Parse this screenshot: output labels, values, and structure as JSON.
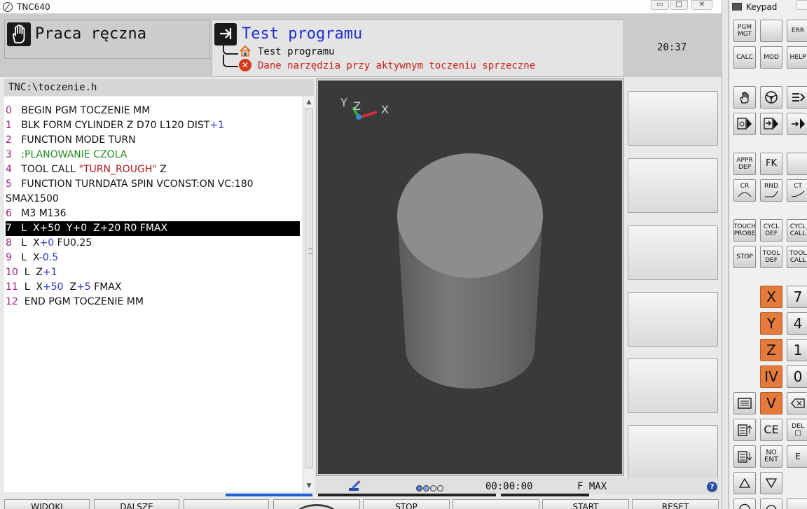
{
  "window": {
    "title": "TNC640"
  },
  "header": {
    "manual_mode_label": "Praca ręczna",
    "test_mode_label": "Test programu",
    "tree_item_1": "Test programu",
    "tree_item_2_error": "Dane narzędzia przy aktywnym toczeniu sprzeczne",
    "clock": "20:37"
  },
  "file": {
    "path": "TNC:\\toczenie.h"
  },
  "program_lines": [
    {
      "n": "0",
      "text": "BEGIN PGM TOCZENIE MM"
    },
    {
      "n": "1",
      "text": "BLK FORM CYLINDER Z D70 L120 DIST+1"
    },
    {
      "n": "2",
      "text": "FUNCTION MODE TURN"
    },
    {
      "n": "3",
      "text": ";PLANOWANIE CZOLA"
    },
    {
      "n": "4",
      "text": "TOOL CALL \"TURN_ROUGH\" Z"
    },
    {
      "n": "5",
      "text": "FUNCTION TURNDATA SPIN VCONST:ON VC:180"
    },
    {
      "n": "",
      "text": "SMAX1500"
    },
    {
      "n": "6",
      "text": "M3 M136"
    },
    {
      "n": "7",
      "text": "L  X+50  Y+0  Z+20 R0 FMAX",
      "selected": true
    },
    {
      "n": "8",
      "text": "L  X+0 FU0.25"
    },
    {
      "n": "9",
      "text": "L  X-0.5"
    },
    {
      "n": "10",
      "text": "L  Z+1"
    },
    {
      "n": "11",
      "text": "L  X+50  Z+5 FMAX"
    },
    {
      "n": "12",
      "text": "END PGM TOCZENIE MM"
    }
  ],
  "graphic": {
    "axis_x": "X",
    "axis_y": "Y",
    "axis_z": "Z",
    "background": "#3a3a3a"
  },
  "status": {
    "time": "00:00:00",
    "feed": "F MAX",
    "help": "?"
  },
  "bottom_softkeys": [
    "WIDOKI",
    "DALSZE",
    "",
    "",
    "STOP",
    "",
    "START",
    "RESET"
  ],
  "keypad": {
    "title": "Keypad",
    "rows": [
      [
        "PGM MGT",
        "",
        "ERR"
      ],
      [
        "CALC",
        "MOD",
        "HELP"
      ],
      [
        "hand-icon",
        "steering-icon",
        "menu-arrow-icon"
      ],
      [
        "program-run-icon",
        "single-block-icon",
        "edit-icon"
      ],
      [
        "APPR DEP",
        "FK",
        ""
      ],
      [
        "CR",
        "RND",
        "CT"
      ],
      [
        "TOUCH PROBE",
        "CYCL DEF",
        "CYCL CALL"
      ],
      [
        "STOP",
        "TOOL DEF",
        "TOOL CALL"
      ],
      [
        "X",
        "7"
      ],
      [
        "Y",
        "4"
      ],
      [
        "Z",
        "1"
      ],
      [
        "IV",
        "0"
      ],
      [
        "V",
        "⌫"
      ],
      [
        "CE",
        "DEL"
      ],
      [
        "NO ENT",
        "E"
      ]
    ]
  }
}
